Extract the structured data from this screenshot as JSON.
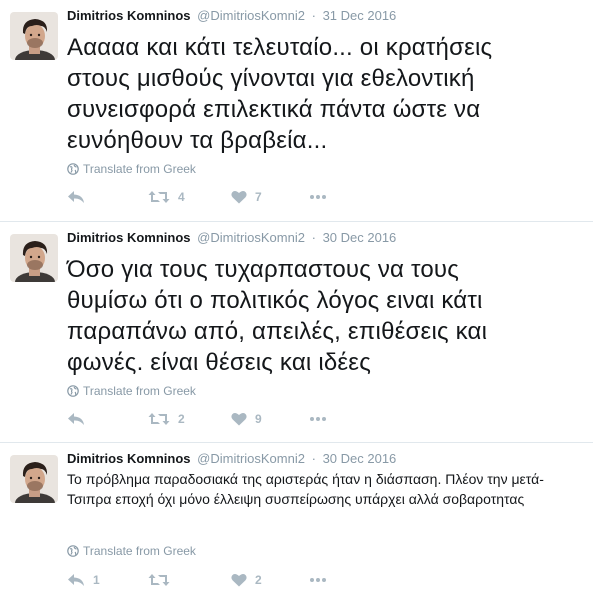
{
  "tweets": [
    {
      "fullname": "Dimitrios Komninos",
      "username": "@DimitriosKomni2",
      "separator": "·",
      "timestamp": "31 Dec 2016",
      "text": "Ααααα και κάτι τελευταίο... οι κρατήσεις στους μισθούς γίνονται για εθελοντική συνεισφορά επιλεκτικά πάντα ώστε να ευνόηθουν τα βραβεία...",
      "translate_label": "Translate from Greek",
      "reply_count": "",
      "retweet_count": "4",
      "like_count": "7"
    },
    {
      "fullname": "Dimitrios Komninos",
      "username": "@DimitriosKomni2",
      "separator": "·",
      "timestamp": "30 Dec 2016",
      "text": "Όσο για τους τυχαρπαστους να τους θυμίσω ότι ο πολιτικός λόγος ειναι κάτι παραπάνω από, απειλές, επιθέσεις και φωνές. είναι θέσεις και ιδέες",
      "translate_label": "Translate from Greek",
      "reply_count": "",
      "retweet_count": "2",
      "like_count": "9"
    },
    {
      "fullname": "Dimitrios Komninos",
      "username": "@DimitriosKomni2",
      "separator": "·",
      "timestamp": "30 Dec 2016",
      "text": "Το πρόβλημα παραδοσιακά της αριστεράς ήταν  η διάσπαση. Πλέον την μετά-Τσιπρα εποχή όχι μόνο έλλειψη συσπείρωσης υπάρχει αλλά σοβαροτητας",
      "translate_label": "Translate from Greek",
      "reply_count": "1",
      "retweet_count": "",
      "like_count": "2"
    }
  ],
  "icons": {
    "avatar": "avatar-photo",
    "globe": "globe-icon",
    "reply": "reply-icon",
    "retweet": "retweet-icon",
    "like": "heart-icon",
    "more": "more-icon"
  },
  "colors": {
    "name": "#14171a",
    "muted": "#8899a6",
    "action": "#aab8c2",
    "divider": "#e1e8ed"
  }
}
